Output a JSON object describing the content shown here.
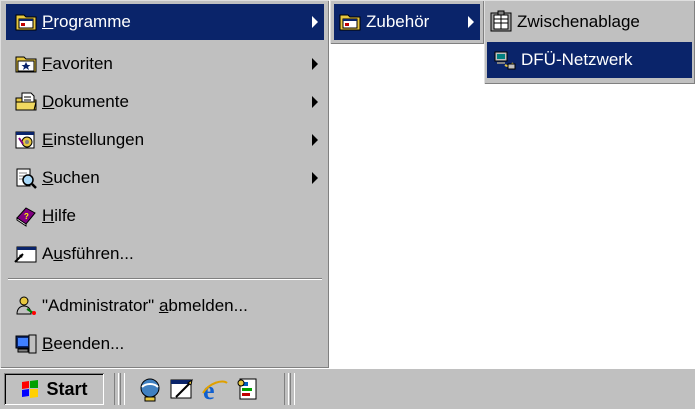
{
  "start_menu": {
    "items": [
      {
        "label_pre": "",
        "label_accel": "P",
        "label_post": "rogramme",
        "icon": "programs-folder-icon",
        "submenu": true,
        "highlighted": true
      },
      {
        "label_pre": "",
        "label_accel": "F",
        "label_post": "avoriten",
        "icon": "favorites-folder-icon",
        "submenu": true
      },
      {
        "label_pre": "",
        "label_accel": "D",
        "label_post": "okumente",
        "icon": "documents-folder-icon",
        "submenu": true
      },
      {
        "label_pre": "",
        "label_accel": "E",
        "label_post": "instellungen",
        "icon": "settings-icon",
        "submenu": true
      },
      {
        "label_pre": "",
        "label_accel": "S",
        "label_post": "uchen",
        "icon": "search-icon",
        "submenu": true
      },
      {
        "label_pre": "",
        "label_accel": "H",
        "label_post": "ilfe",
        "icon": "help-book-icon",
        "submenu": false
      },
      {
        "label_pre": "A",
        "label_accel": "u",
        "label_post": "sführen...",
        "icon": "run-icon",
        "submenu": false
      },
      {
        "label_pre": "\"Administrator\" ",
        "label_accel": "a",
        "label_post": "bmelden...",
        "icon": "logoff-icon",
        "submenu": false
      },
      {
        "label_pre": "",
        "label_accel": "B",
        "label_post": "eenden...",
        "icon": "shutdown-icon",
        "submenu": false
      }
    ]
  },
  "programs_menu": {
    "items": [
      {
        "label": "Zubehör",
        "icon": "accessories-folder-icon",
        "submenu": true,
        "highlighted": true
      }
    ]
  },
  "accessories_menu": {
    "items": [
      {
        "label": "Zwischenablage",
        "icon": "clipboard-icon",
        "highlighted": false
      },
      {
        "label": "DFÜ-Netzwerk",
        "icon": "dialup-network-icon",
        "highlighted": true
      }
    ]
  },
  "taskbar": {
    "start_label": "Start",
    "quick_launch": [
      "outlook-express-icon",
      "show-desktop-icon",
      "internet-explorer-icon",
      "channels-icon"
    ]
  },
  "colors": {
    "menu_bg": "#c0c0c0",
    "highlight": "#0a246a",
    "highlight_text": "#ffffff"
  }
}
